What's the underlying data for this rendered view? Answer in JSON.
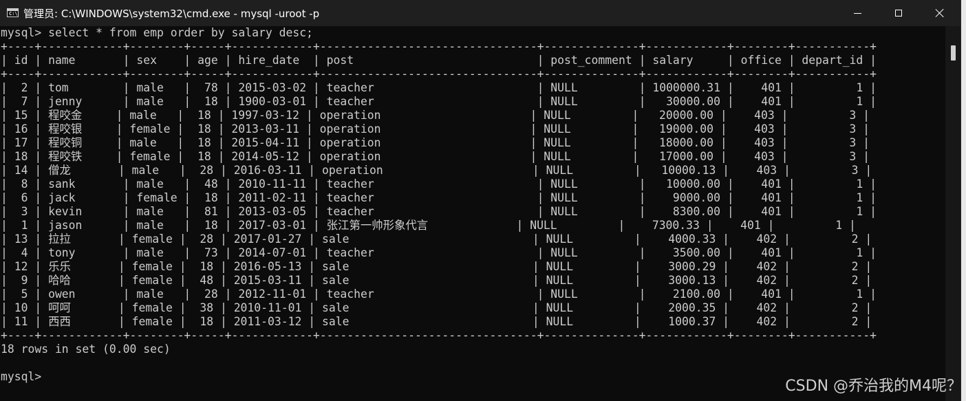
{
  "window": {
    "title": "管理员: C:\\WINDOWS\\system32\\cmd.exe - mysql  -uroot -p",
    "icon": "cmd-icon"
  },
  "console": {
    "command_line": "mysql> select * from emp order by salary desc;",
    "columns": [
      "id",
      "name",
      "sex",
      "age",
      "hire_date",
      "post",
      "post_comment",
      "salary",
      "office",
      "depart_id"
    ],
    "rows": [
      [
        "2",
        "tom",
        "male",
        "78",
        "2015-03-02",
        "teacher",
        "NULL",
        "1000000.31",
        "401",
        "1"
      ],
      [
        "7",
        "jenny",
        "male",
        "18",
        "1900-03-01",
        "teacher",
        "NULL",
        "30000.00",
        "401",
        "1"
      ],
      [
        "15",
        "程咬金",
        "male",
        "18",
        "1997-03-12",
        "operation",
        "NULL",
        "20000.00",
        "403",
        "3"
      ],
      [
        "16",
        "程咬银",
        "female",
        "18",
        "2013-03-11",
        "operation",
        "NULL",
        "19000.00",
        "403",
        "3"
      ],
      [
        "17",
        "程咬铜",
        "male",
        "18",
        "2015-04-11",
        "operation",
        "NULL",
        "18000.00",
        "403",
        "3"
      ],
      [
        "18",
        "程咬铁",
        "female",
        "18",
        "2014-05-12",
        "operation",
        "NULL",
        "17000.00",
        "403",
        "3"
      ],
      [
        "14",
        "僧龙",
        "male",
        "28",
        "2016-03-11",
        "operation",
        "NULL",
        "10000.13",
        "403",
        "3"
      ],
      [
        "8",
        "sank",
        "male",
        "48",
        "2010-11-11",
        "teacher",
        "NULL",
        "10000.00",
        "401",
        "1"
      ],
      [
        "6",
        "jack",
        "female",
        "18",
        "2011-02-11",
        "teacher",
        "NULL",
        "9000.00",
        "401",
        "1"
      ],
      [
        "3",
        "kevin",
        "male",
        "81",
        "2013-03-05",
        "teacher",
        "NULL",
        "8300.00",
        "401",
        "1"
      ],
      [
        "1",
        "jason",
        "male",
        "18",
        "2017-03-01",
        "张江第一帅形象代言",
        "NULL",
        "7300.33",
        "401",
        "1"
      ],
      [
        "13",
        "拉拉",
        "female",
        "28",
        "2017-01-27",
        "sale",
        "NULL",
        "4000.33",
        "402",
        "2"
      ],
      [
        "4",
        "tony",
        "male",
        "73",
        "2014-07-01",
        "teacher",
        "NULL",
        "3500.00",
        "401",
        "1"
      ],
      [
        "12",
        "乐乐",
        "female",
        "18",
        "2016-05-13",
        "sale",
        "NULL",
        "3000.29",
        "402",
        "2"
      ],
      [
        "9",
        "哈哈",
        "female",
        "48",
        "2015-03-11",
        "sale",
        "NULL",
        "3000.13",
        "402",
        "2"
      ],
      [
        "5",
        "owen",
        "male",
        "28",
        "2012-11-01",
        "teacher",
        "NULL",
        "2100.00",
        "401",
        "1"
      ],
      [
        "10",
        "呵呵",
        "female",
        "38",
        "2010-11-01",
        "sale",
        "NULL",
        "2000.35",
        "402",
        "2"
      ],
      [
        "11",
        "西西",
        "female",
        "18",
        "2011-03-12",
        "sale",
        "NULL",
        "1000.37",
        "402",
        "2"
      ]
    ],
    "summary": "18 rows in set (0.00 sec)",
    "prompt": "mysql>"
  },
  "watermark": "CSDN @乔治我的M4呢？"
}
